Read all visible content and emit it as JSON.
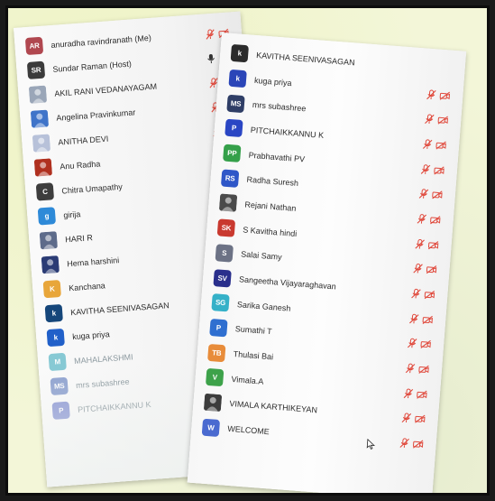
{
  "colors": {
    "muted_red": "#e0493c",
    "background_tint": "#f3f6d8"
  },
  "left_panel": {
    "participants": [
      {
        "initials": "AR",
        "name": "anuradha ravindranath (Me)",
        "avatar_color": "#b0474f",
        "photo": false,
        "mic": "muted",
        "cam": "off",
        "faded": false
      },
      {
        "initials": "SR",
        "name": "Sundar Raman (Host)",
        "avatar_color": "#3b3b3b",
        "photo": false,
        "mic": "host",
        "cam": "off",
        "faded": false
      },
      {
        "initials": "",
        "name": "AKIL RANI VEDANAYAGAM",
        "avatar_color": "#9aa6b8",
        "photo": true,
        "mic": "muted",
        "cam": "off",
        "faded": false
      },
      {
        "initials": "",
        "name": "Angelina Pravinkumar",
        "avatar_color": "#3f74c9",
        "photo": true,
        "mic": "muted",
        "cam": "off",
        "faded": false
      },
      {
        "initials": "",
        "name": "ANITHA DEVI",
        "avatar_color": "#b7c1d9",
        "photo": true,
        "mic": "muted",
        "cam": "off",
        "faded": false
      },
      {
        "initials": "",
        "name": "Anu Radha",
        "avatar_color": "#b0301f",
        "photo": true,
        "mic": "muted",
        "cam": "off",
        "faded": false
      },
      {
        "initials": "C",
        "name": "Chitra Umapathy",
        "avatar_color": "#3d3d3d",
        "photo": false,
        "mic": "muted",
        "cam": "off",
        "faded": false
      },
      {
        "initials": "g",
        "name": "girija",
        "avatar_color": "#2e8ad8",
        "photo": false,
        "mic": "muted",
        "cam": "off",
        "faded": false
      },
      {
        "initials": "",
        "name": "HARI R",
        "avatar_color": "#5d6b8a",
        "photo": true,
        "mic": "muted",
        "cam": "off",
        "faded": false
      },
      {
        "initials": "",
        "name": "Hema harshini",
        "avatar_color": "#2b3c75",
        "photo": true,
        "mic": "muted",
        "cam": "off",
        "faded": false
      },
      {
        "initials": "K",
        "name": "Kanchana",
        "avatar_color": "#e8a63a",
        "photo": false,
        "mic": "muted",
        "cam": "off",
        "faded": false
      },
      {
        "initials": "k",
        "name": "KAVITHA SEENIVASAGAN",
        "avatar_color": "#15467a",
        "photo": false,
        "mic": "muted",
        "cam": "off",
        "faded": false
      },
      {
        "initials": "k",
        "name": "kuga priya",
        "avatar_color": "#2160c9",
        "photo": false,
        "mic": "muted",
        "cam": "off",
        "faded": false
      },
      {
        "initials": "M",
        "name": "MAHALAKSHMI",
        "avatar_color": "#2aa2b6",
        "photo": false,
        "mic": "muted",
        "cam": "off",
        "faded": true
      },
      {
        "initials": "MS",
        "name": "mrs subashree",
        "avatar_color": "#3b5db0",
        "photo": false,
        "mic": "muted",
        "cam": "off",
        "faded": true
      },
      {
        "initials": "P",
        "name": "PITCHAIKKANNU K",
        "avatar_color": "#3b4fb8",
        "photo": false,
        "mic": "muted",
        "cam": "off",
        "faded": true
      }
    ]
  },
  "right_panel": {
    "participants": [
      {
        "initials": "k",
        "name": "KAVITHA SEENIVASAGAN",
        "avatar_color": "#2b2b2b",
        "photo": false,
        "mic": "none",
        "cam": "none",
        "faded": false
      },
      {
        "initials": "k",
        "name": "kuga priya",
        "avatar_color": "#2a45b8",
        "photo": false,
        "mic": "muted",
        "cam": "off",
        "faded": false
      },
      {
        "initials": "MS",
        "name": "mrs subashree",
        "avatar_color": "#2f3e66",
        "photo": false,
        "mic": "muted",
        "cam": "off",
        "faded": false
      },
      {
        "initials": "P",
        "name": "PITCHAIKKANNU K",
        "avatar_color": "#2a46c4",
        "photo": false,
        "mic": "muted",
        "cam": "off",
        "faded": false
      },
      {
        "initials": "PP",
        "name": "Prabhavathi PV",
        "avatar_color": "#35a04a",
        "photo": false,
        "mic": "muted",
        "cam": "off",
        "faded": false
      },
      {
        "initials": "RS",
        "name": "Radha Suresh",
        "avatar_color": "#2f57c8",
        "photo": false,
        "mic": "muted",
        "cam": "off",
        "faded": false
      },
      {
        "initials": "",
        "name": "Rejani Nathan",
        "avatar_color": "#4a4a4a",
        "photo": true,
        "mic": "muted",
        "cam": "off",
        "faded": false
      },
      {
        "initials": "SK",
        "name": "S Kavitha hindi",
        "avatar_color": "#c9392f",
        "photo": false,
        "mic": "muted",
        "cam": "off",
        "faded": false
      },
      {
        "initials": "S",
        "name": "Salai Samy",
        "avatar_color": "#6c7285",
        "photo": false,
        "mic": "muted",
        "cam": "off",
        "faded": false
      },
      {
        "initials": "SV",
        "name": "Sangeetha Vijayaraghavan",
        "avatar_color": "#2a2f8c",
        "photo": false,
        "mic": "muted",
        "cam": "off",
        "faded": false
      },
      {
        "initials": "SG",
        "name": "Sarika Ganesh",
        "avatar_color": "#35b1c8",
        "photo": false,
        "mic": "muted",
        "cam": "off",
        "faded": false
      },
      {
        "initials": "P",
        "name": "Sumathi T",
        "avatar_color": "#2f6fd0",
        "photo": false,
        "mic": "muted",
        "cam": "off",
        "faded": false
      },
      {
        "initials": "TB",
        "name": "Thulasi Bai",
        "avatar_color": "#e88c3a",
        "photo": false,
        "mic": "muted",
        "cam": "off",
        "faded": false
      },
      {
        "initials": "V",
        "name": "Vimala.A",
        "avatar_color": "#3da24a",
        "photo": false,
        "mic": "muted",
        "cam": "off",
        "faded": false
      },
      {
        "initials": "",
        "name": "VIMALA KARTHIKEYAN",
        "avatar_color": "#3c3c3c",
        "photo": true,
        "mic": "muted",
        "cam": "off",
        "faded": false
      },
      {
        "initials": "W",
        "name": "WELCOME",
        "avatar_color": "#4a6ad0",
        "photo": false,
        "mic": "muted",
        "cam": "off",
        "faded": false
      }
    ]
  }
}
